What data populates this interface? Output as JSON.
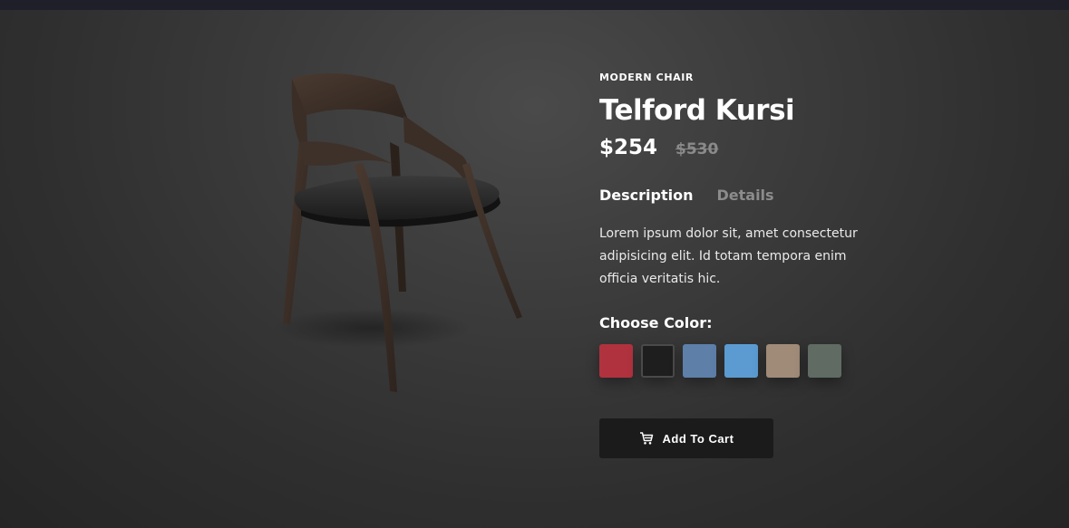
{
  "product": {
    "category": "MODERN CHAIR",
    "name": "Telford Kursi",
    "price": "$254",
    "old_price": "$530",
    "image_icon": "chair-image"
  },
  "tabs": [
    {
      "label": "Description",
      "active": true
    },
    {
      "label": "Details",
      "active": false
    }
  ],
  "description": "Lorem ipsum dolor sit, amet consectetur adipisicing elit. Id totam tempora enim officia veritatis hic.",
  "colors": {
    "label": "Choose Color:",
    "swatches": [
      {
        "name": "red",
        "color": "#b0323e"
      },
      {
        "name": "black",
        "color": "#1e1e1e",
        "selected": true
      },
      {
        "name": "denim",
        "color": "#5d7fa8"
      },
      {
        "name": "light-blue",
        "color": "#5b9bd1"
      },
      {
        "name": "beige",
        "color": "#a08a78"
      },
      {
        "name": "gray-green",
        "color": "#5f6b63"
      }
    ]
  },
  "cart": {
    "label": "Add To Cart",
    "icon": "cart-icon"
  },
  "theme": {
    "background": "#3d3d3d",
    "button_bg": "#1b1b1b",
    "text": "#ffffff",
    "muted": "#8c8c8c"
  }
}
